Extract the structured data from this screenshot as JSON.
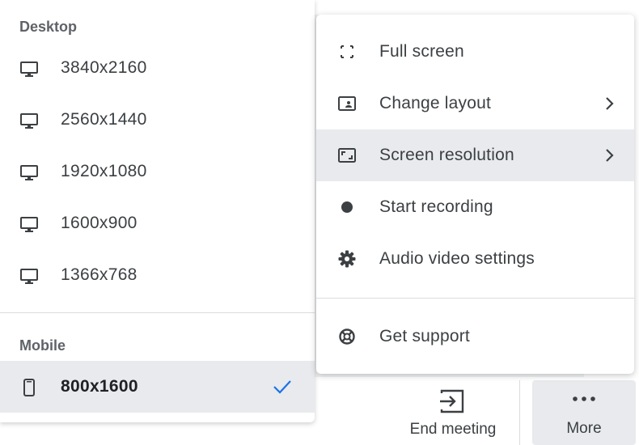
{
  "resolution_menu": {
    "desktop_label": "Desktop",
    "desktop_items": [
      "3840x2160",
      "2560x1440",
      "1920x1080",
      "1600x900",
      "1366x768"
    ],
    "mobile_label": "Mobile",
    "mobile_items": [
      {
        "label": "800x1600",
        "selected": true
      }
    ]
  },
  "more_menu": {
    "items": [
      {
        "label": "Full screen",
        "icon": "fullscreen-icon"
      },
      {
        "label": "Change layout",
        "icon": "layout-icon",
        "submenu": true
      },
      {
        "label": "Screen resolution",
        "icon": "screen-resolution-icon",
        "submenu": true,
        "active": true
      },
      {
        "label": "Start recording",
        "icon": "record-icon"
      },
      {
        "label": "Audio video settings",
        "icon": "gear-icon"
      },
      {
        "label": "Get support",
        "icon": "support-icon"
      }
    ]
  },
  "bottom_bar": {
    "end_meeting_label": "End meeting",
    "more_label": "More"
  },
  "colors": {
    "accent": "#1a73e8",
    "selected_bg": "#e8eaed",
    "text": "#3c4043"
  }
}
